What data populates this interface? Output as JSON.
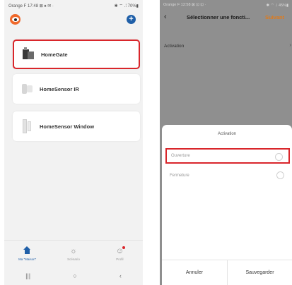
{
  "left_phone": {
    "status": {
      "left": "Orange F 17:48 ⊠ ♠ ✉ ·",
      "right": "✱ ⌔ .⁞ 70%▮"
    },
    "devices": [
      {
        "label": "HomeGate",
        "highlighted": true
      },
      {
        "label": "HomeSensor IR",
        "highlighted": false
      },
      {
        "label": "HomeSensor Window",
        "highlighted": false
      }
    ],
    "tabs": [
      {
        "label": "Ma \"Maison\"",
        "active": true
      },
      {
        "label": "Scénario",
        "active": false
      },
      {
        "label": "Profil",
        "active": false
      }
    ],
    "nav": {
      "recents": "|||",
      "home": "○",
      "back": "‹"
    },
    "colors": {
      "accent": "#1f5fa8",
      "highlight": "#d9262b",
      "logo": "#f0692b"
    }
  },
  "right_phone": {
    "status": {
      "left": "Orange F 12:58 ⊠ ⊡ ⊡ ·",
      "right": "✱ ⌔ .⁞ 45%▮"
    },
    "header": {
      "back": "‹",
      "title": "Sélectionner une foncti...",
      "next": "Suivant"
    },
    "row": {
      "label": "Activation",
      "chevron": "›"
    },
    "sheet": {
      "title": "Activation",
      "options": [
        {
          "label": "Ouverture",
          "highlighted": true
        },
        {
          "label": "Fermeture",
          "highlighted": false
        }
      ],
      "cancel": "Annuler",
      "save": "Sauvegarder"
    },
    "colors": {
      "next": "#e07a1a",
      "overlay": "#8f8f8f"
    }
  }
}
